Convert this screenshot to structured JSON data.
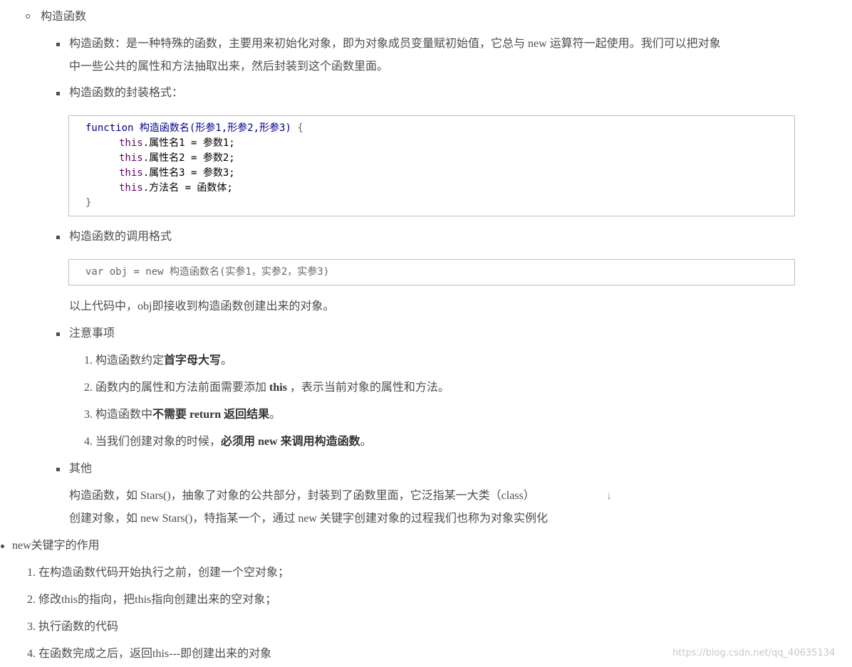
{
  "section": {
    "title": "构造函数",
    "items": {
      "definition": {
        "line1": "构造函数：是一种特殊的函数，主要用来初始化对象，即为对象成员变量赋初始值，它总与 new 运算符一起使用。我们可以把对象",
        "line2": "中一些公共的属性和方法抽取出来，然后封装到这个函数里面。"
      },
      "wrap_format": {
        "label": "构造函数的封装格式：",
        "code": {
          "l1_kw": "function",
          "l1_name": "构造函数名",
          "l1_args": "(形参1,形参2,形参3)",
          "l1_brace": " {",
          "l2_this": "this",
          "l2_rest": ".属性名1 = 参数1;",
          "l3_this": "this",
          "l3_rest": ".属性名2 = 参数2;",
          "l4_this": "this",
          "l4_rest": ".属性名3 = 参数3;",
          "l5_this": "this",
          "l5_rest": ".方法名 = 函数体;",
          "l6": "}"
        }
      },
      "call_format": {
        "label": "构造函数的调用格式",
        "code": "var obj = new 构造函数名(实参1，实参2，实参3)",
        "note": "以上代码中，obj即接收到构造函数创建出来的对象。"
      },
      "notes": {
        "label": "注意事项",
        "items": [
          {
            "num": "1.",
            "pre": "构造函数约定",
            "bold": "首字母大写",
            "post": "。"
          },
          {
            "num": "2.",
            "pre": "函数内的属性和方法前面需要添加 ",
            "bold": "this",
            "post": " ，表示当前对象的属性和方法。"
          },
          {
            "num": "3.",
            "pre": "构造函数中",
            "bold": "不需要 return 返回结果",
            "post": "。"
          },
          {
            "num": "4.",
            "pre": "当我们创建对象的时候，",
            "bold": "必须用 new 来调用构造函数",
            "post": "。"
          }
        ]
      },
      "other": {
        "label": "其他",
        "line1": "构造函数，如 Stars()，抽象了对象的公共部分，封装到了函数里面，它泛指某一大类（class）",
        "arrow": "↓",
        "line2": "创建对象，如 new Stars()，特指某一个，通过 new 关键字创建对象的过程我们也称为对象实例化"
      }
    }
  },
  "new_keyword": {
    "title": "new关键字的作用",
    "items": [
      {
        "num": "1.",
        "text": "在构造函数代码开始执行之前，创建一个空对象；"
      },
      {
        "num": "2.",
        "text": "修改this的指向，把this指向创建出来的空对象；"
      },
      {
        "num": "3.",
        "text": "执行函数的代码"
      },
      {
        "num": "4.",
        "text": "在函数完成之后，返回this---即创建出来的对象"
      }
    ]
  },
  "watermark": "https://blog.csdn.net/qq_40635134"
}
